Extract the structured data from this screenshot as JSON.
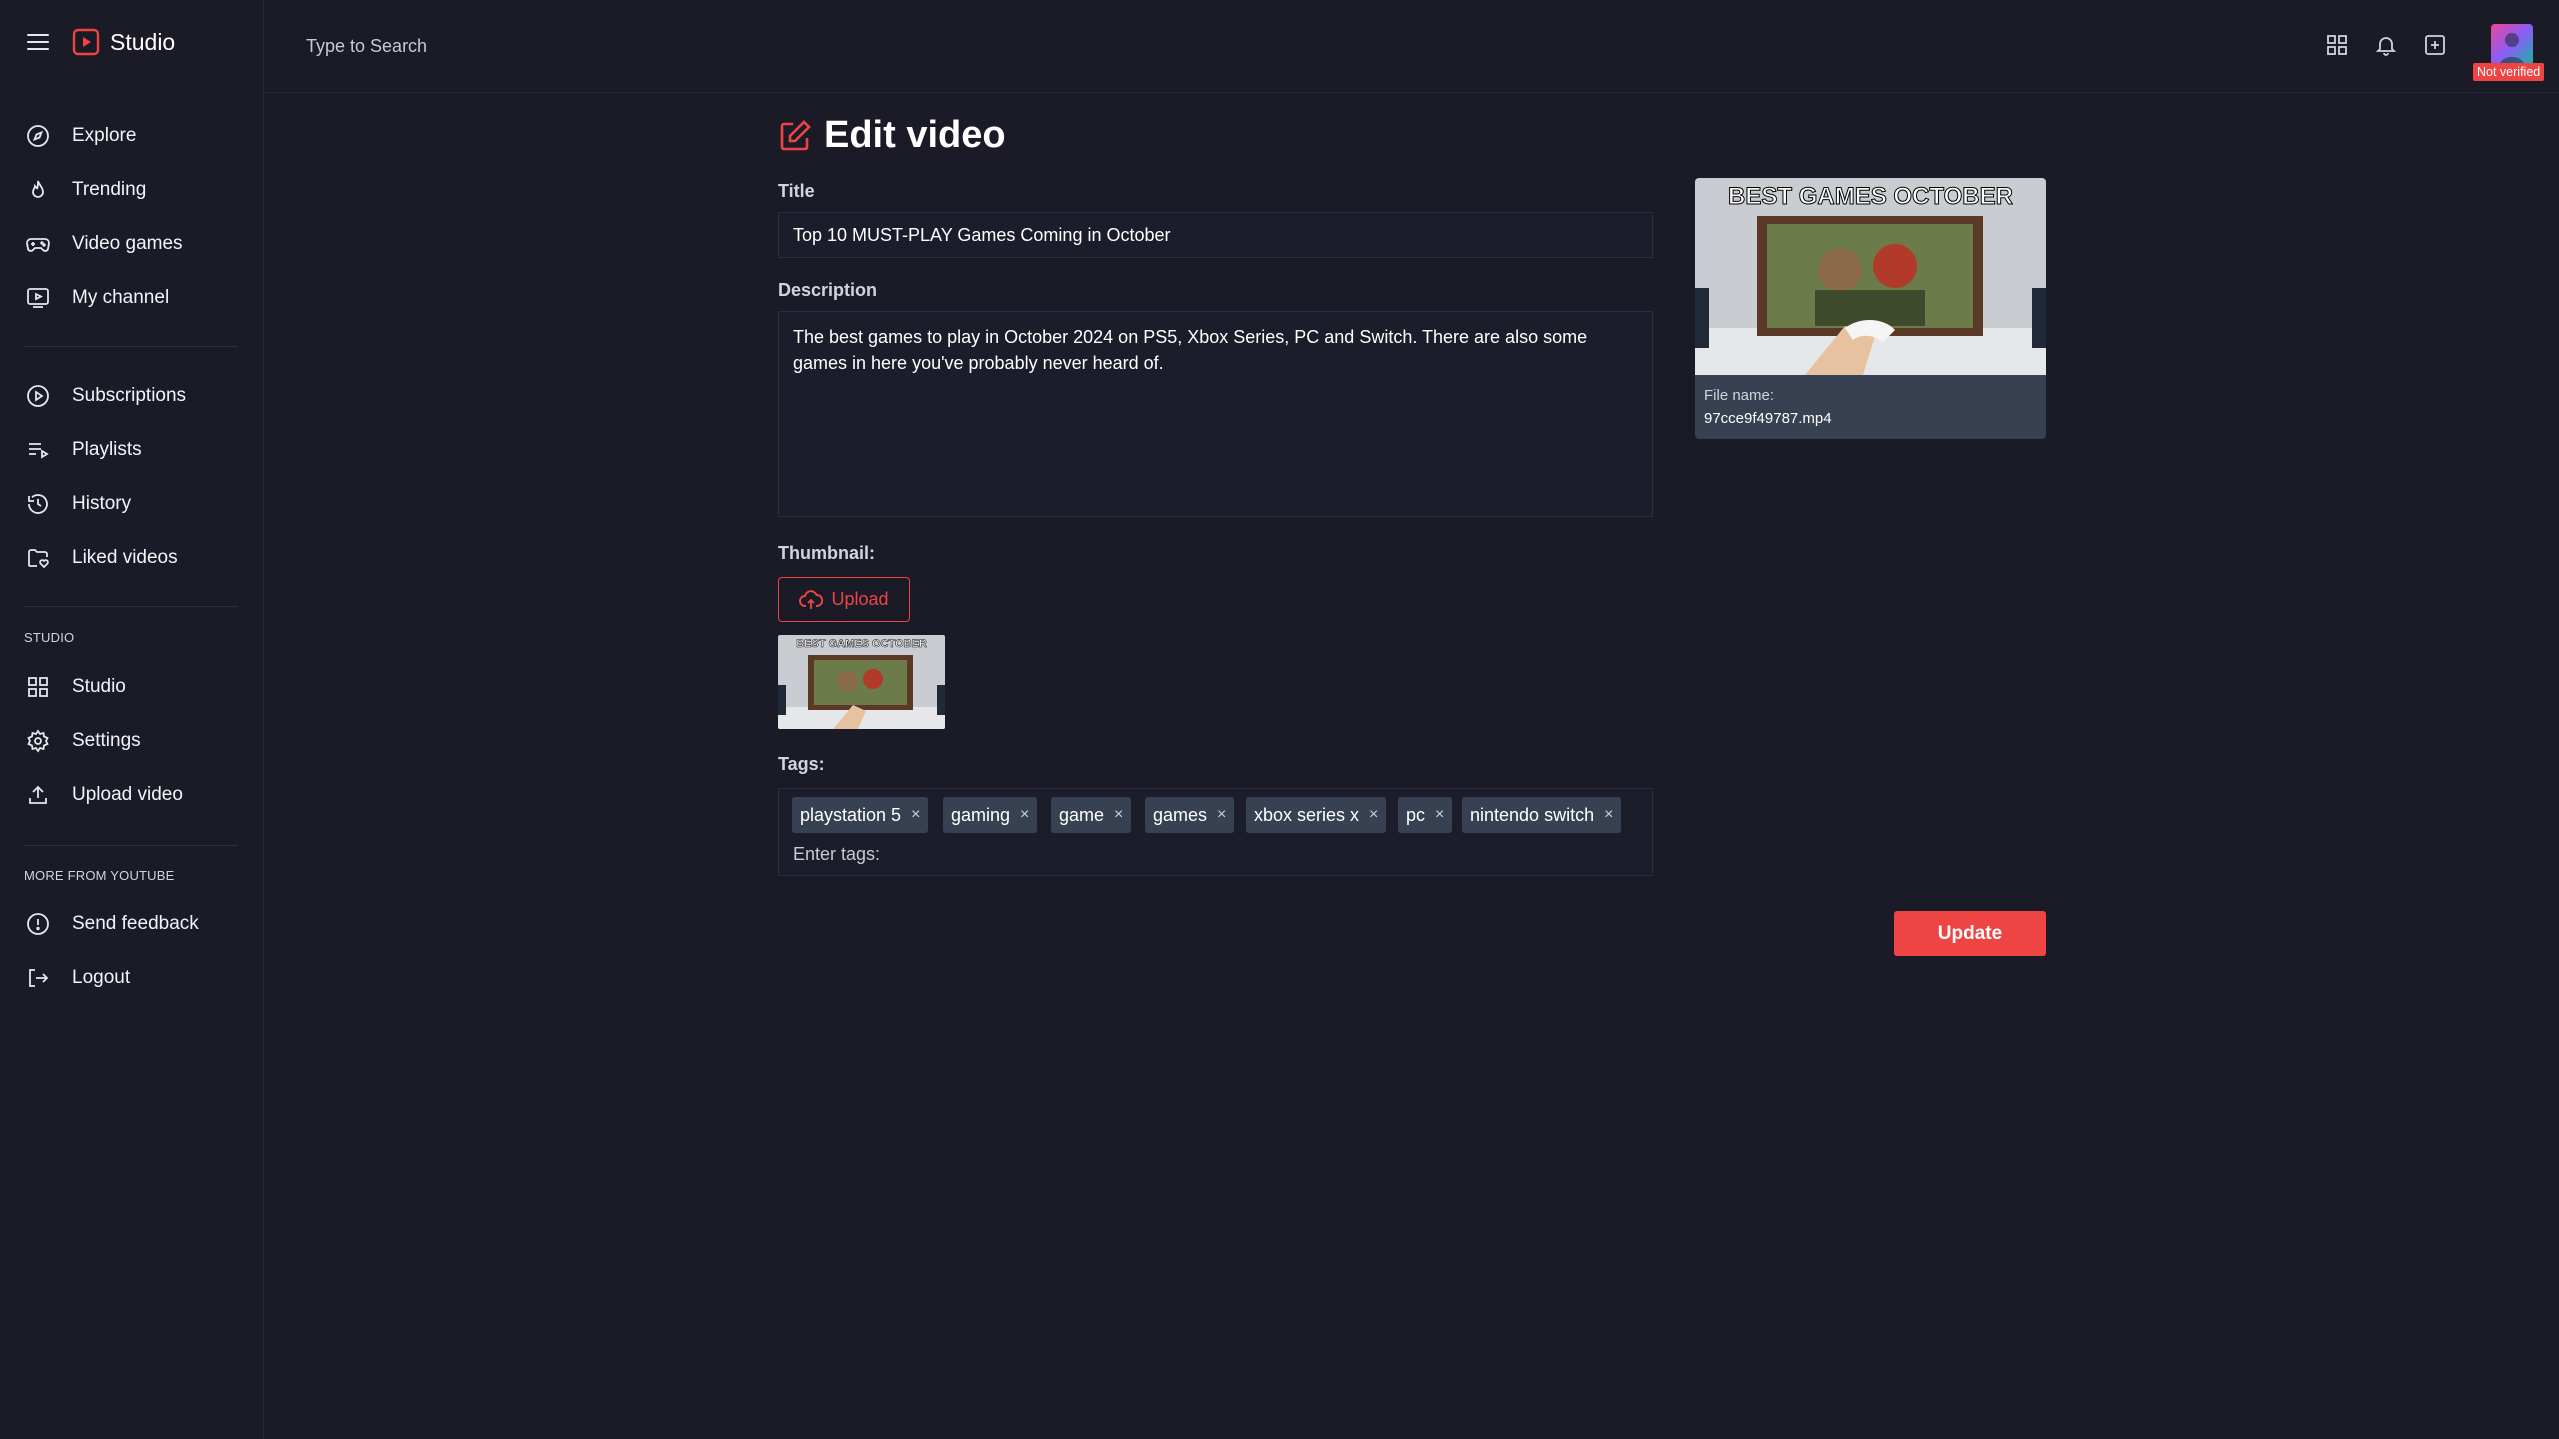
{
  "app": {
    "name": "Studio"
  },
  "search": {
    "placeholder": "Type to Search"
  },
  "sidebar": {
    "main_items": [
      {
        "label": "Explore",
        "icon": "compass-icon"
      },
      {
        "label": "Trending",
        "icon": "flame-icon"
      },
      {
        "label": "Video games",
        "icon": "gamepad-icon"
      },
      {
        "label": "My channel",
        "icon": "channel-icon"
      }
    ],
    "library_items": [
      {
        "label": "Subscriptions",
        "icon": "play-circle-icon"
      },
      {
        "label": "Playlists",
        "icon": "playlist-icon"
      },
      {
        "label": "History",
        "icon": "history-icon"
      },
      {
        "label": "Liked videos",
        "icon": "heart-folder-icon"
      }
    ],
    "studio_title": "STUDIO",
    "studio_items": [
      {
        "label": "Studio",
        "icon": "grid-icon"
      },
      {
        "label": "Settings",
        "icon": "gear-icon"
      },
      {
        "label": "Upload video",
        "icon": "upload-icon"
      }
    ],
    "more_title": "MORE FROM YOUTUBE",
    "more_items": [
      {
        "label": "Send feedback",
        "icon": "alert-circle-icon"
      },
      {
        "label": "Logout",
        "icon": "logout-icon"
      }
    ]
  },
  "user": {
    "status_badge": "Not verified"
  },
  "page": {
    "title": "Edit video",
    "title_label": "Title",
    "title_value": "Top 10 MUST-PLAY Games Coming in October",
    "description_label": "Description",
    "description_value": "The best games to play in October 2024 on PS5, Xbox Series, PC and Switch. There are also some games in here you've probably never heard of.",
    "thumbnail_label": "Thumbnail:",
    "upload_label": "Upload",
    "tags_label": "Tags:",
    "tags": [
      "playstation 5",
      "gaming",
      "game",
      "games",
      "xbox series x",
      "pc",
      "nintendo switch"
    ],
    "tags_placeholder": "Enter tags:",
    "update_label": "Update",
    "thumbnail_text": "BEST GAMES OCTOBER"
  },
  "preview": {
    "file_name_label": "File name:",
    "file_name": "97cce9f49787.mp4"
  },
  "colors": {
    "accent": "#ef4444",
    "background": "#1a1b27",
    "panel": "#374151"
  },
  "tag_close_glyph": "×"
}
